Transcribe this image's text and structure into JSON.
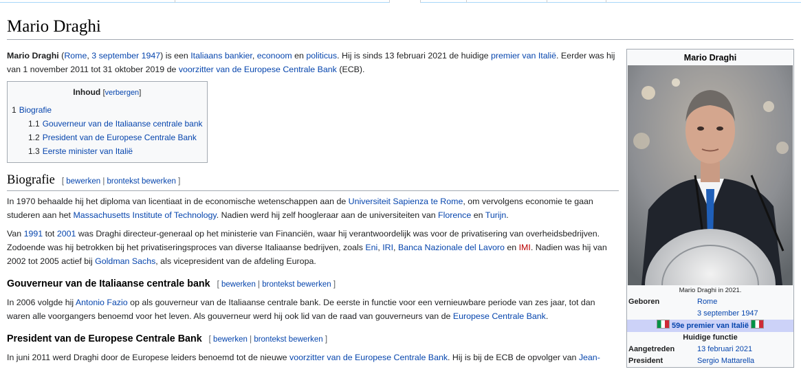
{
  "title": "Mario Draghi",
  "intro": {
    "p1": {
      "name": "Mario Draghi",
      "t1": " (",
      "birth_place": "Rome",
      "t2": ", ",
      "birth_date": "3 september 1947",
      "t3": ") is een ",
      "l1": "Italiaans",
      "t4": " ",
      "l2": "bankier",
      "t5": ", ",
      "l3": "econoom",
      "t6": " en ",
      "l4": "politicus",
      "t7": ". Hij is sinds 13 februari 2021 de huidige ",
      "l5": "premier van Italië",
      "t8": ". Eerder was hij van 1 november 2011 tot 31 oktober 2019 de ",
      "l6": "voorzitter van de Europese Centrale Bank",
      "t9": " (ECB)."
    }
  },
  "toc": {
    "title": "Inhoud",
    "toggle": "verbergen",
    "items": [
      {
        "num": "1",
        "label": "Biografie"
      },
      {
        "num": "1.1",
        "label": "Gouverneur van de Italiaanse centrale bank"
      },
      {
        "num": "1.2",
        "label": "President van de Europese Centrale Bank"
      },
      {
        "num": "1.3",
        "label": "Eerste minister van Italië"
      }
    ]
  },
  "edit": {
    "edit": "bewerken",
    "source": "brontekst bewerken",
    "sep": " | ",
    "open": "[ ",
    "close": " ]"
  },
  "biografie": {
    "heading": "Biografie",
    "p1": {
      "t1": "In 1970 behaalde hij het diploma van licentiaat in de economische wetenschappen aan de ",
      "l1": "Universiteit Sapienza te Rome",
      "t2": ", om vervolgens economie te gaan studeren aan het ",
      "l2": "Massachusetts Institute of Technology",
      "t3": ". Nadien werd hij zelf hoogleraar aan de universiteiten van ",
      "l3": "Florence",
      "t4": " en ",
      "l4": "Turijn",
      "t5": "."
    },
    "p2": {
      "t1": "Van ",
      "l1": "1991",
      "t2": " tot ",
      "l2": "2001",
      "t3": " was Draghi directeur-generaal op het ministerie van Financiën, waar hij verantwoordelijk was voor de privatisering van overheidsbedrijven. Zodoende was hij betrokken bij het privatiseringsproces van diverse Italiaanse bedrijven, zoals ",
      "l3": "Eni",
      "t4": ", ",
      "l4": "IRI",
      "t5": ", ",
      "l5": "Banca Nazionale del Lavoro",
      "t6": " en ",
      "l6": "IMI",
      "t7": ". Nadien was hij van 2002 tot 2005 actief bij ",
      "l7": "Goldman Sachs",
      "t8": ", als vicepresident van de afdeling Europa."
    }
  },
  "gouverneur": {
    "heading": "Gouverneur van de Italiaanse centrale bank",
    "p1": {
      "t1": "In 2006 volgde hij ",
      "l1": "Antonio Fazio",
      "t2": " op als gouverneur van de Italiaanse centrale bank. De eerste in functie voor een vernieuwbare periode van zes jaar, tot dan waren alle voorgangers benoemd voor het leven. Als gouverneur werd hij ook lid van de raad van gouverneurs van de ",
      "l2": "Europese Centrale Bank",
      "t3": "."
    }
  },
  "president": {
    "heading": "President van de Europese Centrale Bank",
    "p1": {
      "t1": "In juni 2011 werd Draghi door de Europese leiders benoemd tot de nieuwe ",
      "l1": "voorzitter van de Europese Centrale Bank",
      "t2": ". Hij is bij de ECB de opvolger van ",
      "l2": "Jean-"
    }
  },
  "infobox": {
    "title": "Mario Draghi",
    "photo_name": "portrait-photo",
    "caption": "Mario Draghi in 2021.",
    "born_label": "Geboren",
    "born_place": "Rome",
    "born_date": "3 september 1947",
    "office": "59e premier van Italië",
    "current": "Huidige functie",
    "took_office_label": "Aangetreden",
    "took_office": "13 februari 2021",
    "president_label": "President",
    "president": "Sergio Mattarella"
  },
  "colors": {
    "link": "#0645ad",
    "redlink": "#ba0000",
    "band": "#ccd2f8",
    "border": "#a2a9b1"
  }
}
